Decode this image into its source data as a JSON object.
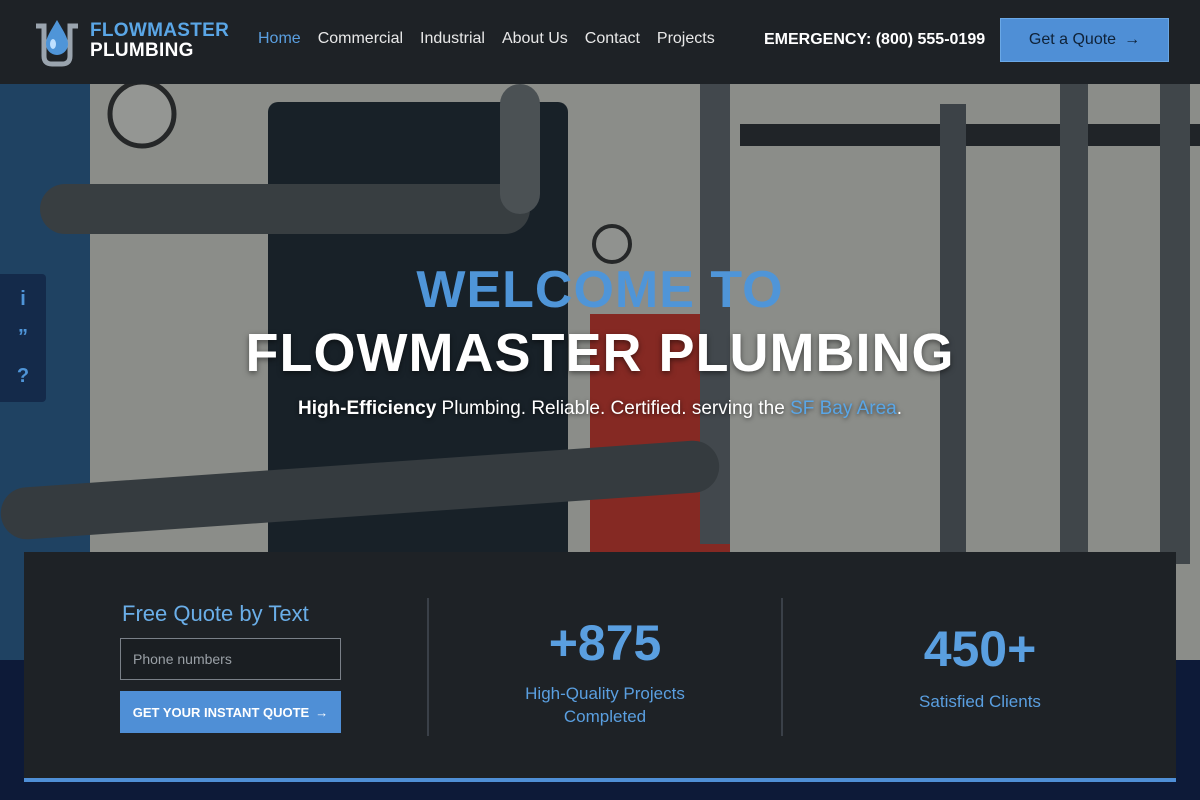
{
  "brand": {
    "line1": "FLOWMASTER",
    "line2": "PLUMBING"
  },
  "nav": [
    {
      "label": "Home",
      "active": true
    },
    {
      "label": "Commercial"
    },
    {
      "label": "Industrial"
    },
    {
      "label": "About Us"
    },
    {
      "label": "Contact"
    },
    {
      "label": "Projects"
    }
  ],
  "emergency": "EMERGENCY: (800) 555-0199",
  "header_cta": {
    "label": "Get a Quote",
    "icon": "arrow-right-icon"
  },
  "side_tab": {
    "icons": [
      "info-icon",
      "quote-icon",
      "help-icon"
    ],
    "glyphs": [
      "i",
      "”",
      "?"
    ]
  },
  "hero": {
    "title1": "WELCOME TO",
    "title2": "FLOWMASTER PLUMBING",
    "sub_bold": "High-Efficiency",
    "sub_mid": " Plumbing. Reliable. Certified. serving the ",
    "sub_hl": "SF Bay Area",
    "sub_end": "."
  },
  "quote_form": {
    "title": "Free Quote by Text",
    "phone_placeholder": "Phone numbers",
    "button_label": "GET YOUR INSTANT QUOTE",
    "button_icon": "arrow-right-icon"
  },
  "stats": [
    {
      "value": "+875",
      "label_line1": "High-Quality Projects",
      "label_line2": "Completed"
    },
    {
      "value": "450+",
      "label_line1": "Satisfied Clients",
      "label_line2": ""
    }
  ],
  "colors": {
    "accent": "#4f8fd6",
    "header_bg": "#1e2226",
    "page_bg": "#0d1a38"
  }
}
